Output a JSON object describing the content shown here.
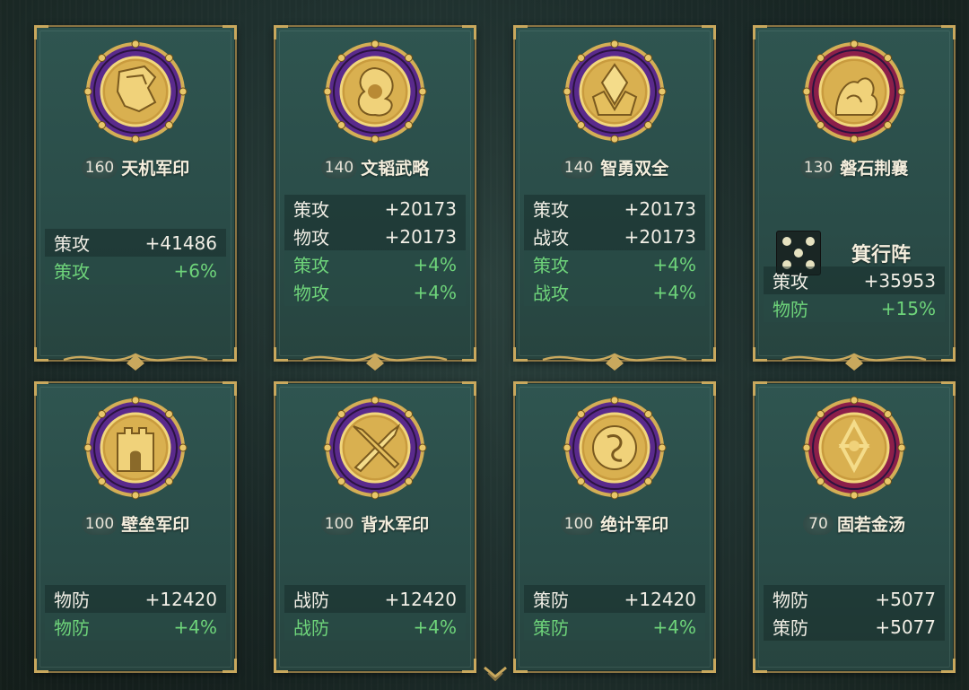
{
  "colors": {
    "accent_gold": "#c9a85d",
    "green_bonus": "#6ed47a",
    "purple_ring": "#5a2a8c",
    "crimson_ring": "#8c1f4a"
  },
  "cards": [
    {
      "level": "160",
      "name": "天机军印",
      "ring": "purple",
      "icon": "scroll-map-icon",
      "stats": [
        {
          "label": "策攻",
          "value": "+41486",
          "green": false
        },
        {
          "label": "策攻",
          "value": "+6%",
          "green": true
        }
      ]
    },
    {
      "level": "140",
      "name": "文韬武略",
      "ring": "purple",
      "icon": "swirl-emblem-icon",
      "stats": [
        {
          "label": "策攻",
          "value": "+20173",
          "green": false
        },
        {
          "label": "物攻",
          "value": "+20173",
          "green": false
        },
        {
          "label": "策攻",
          "value": "+4%",
          "green": true
        },
        {
          "label": "物攻",
          "value": "+4%",
          "green": true
        }
      ]
    },
    {
      "level": "140",
      "name": "智勇双全",
      "ring": "purple",
      "icon": "crystal-crown-icon",
      "stats": [
        {
          "label": "策攻",
          "value": "+20173",
          "green": false
        },
        {
          "label": "战攻",
          "value": "+20173",
          "green": false
        },
        {
          "label": "策攻",
          "value": "+4%",
          "green": true
        },
        {
          "label": "战攻",
          "value": "+4%",
          "green": true
        }
      ]
    },
    {
      "level": "130",
      "name": "磐石荆襄",
      "ring": "crimson",
      "icon": "rock-emblem-icon",
      "formation": "箕行阵",
      "stats": [
        {
          "label": "策攻",
          "value": "+35953",
          "green": false
        },
        {
          "label": "物防",
          "value": "+15%",
          "green": true
        }
      ]
    },
    {
      "level": "100",
      "name": "壁垒军印",
      "ring": "purple",
      "icon": "fortress-wall-icon",
      "stats": [
        {
          "label": "物防",
          "value": "+12420",
          "green": false
        },
        {
          "label": "物防",
          "value": "+4%",
          "green": true
        }
      ]
    },
    {
      "level": "100",
      "name": "背水军印",
      "ring": "purple",
      "icon": "crossed-swords-icon",
      "stats": [
        {
          "label": "战防",
          "value": "+12420",
          "green": false
        },
        {
          "label": "战防",
          "value": "+4%",
          "green": true
        }
      ]
    },
    {
      "level": "100",
      "name": "绝计军印",
      "ring": "purple",
      "icon": "dragon-coin-icon",
      "stats": [
        {
          "label": "策防",
          "value": "+12420",
          "green": false
        },
        {
          "label": "策防",
          "value": "+4%",
          "green": true
        }
      ]
    },
    {
      "level": "70",
      "name": "固若金汤",
      "ring": "crimson",
      "icon": "hexagram-emblem-icon",
      "stats": [
        {
          "label": "物防",
          "value": "+5077",
          "green": false
        },
        {
          "label": "策防",
          "value": "+5077",
          "green": false
        }
      ]
    }
  ]
}
